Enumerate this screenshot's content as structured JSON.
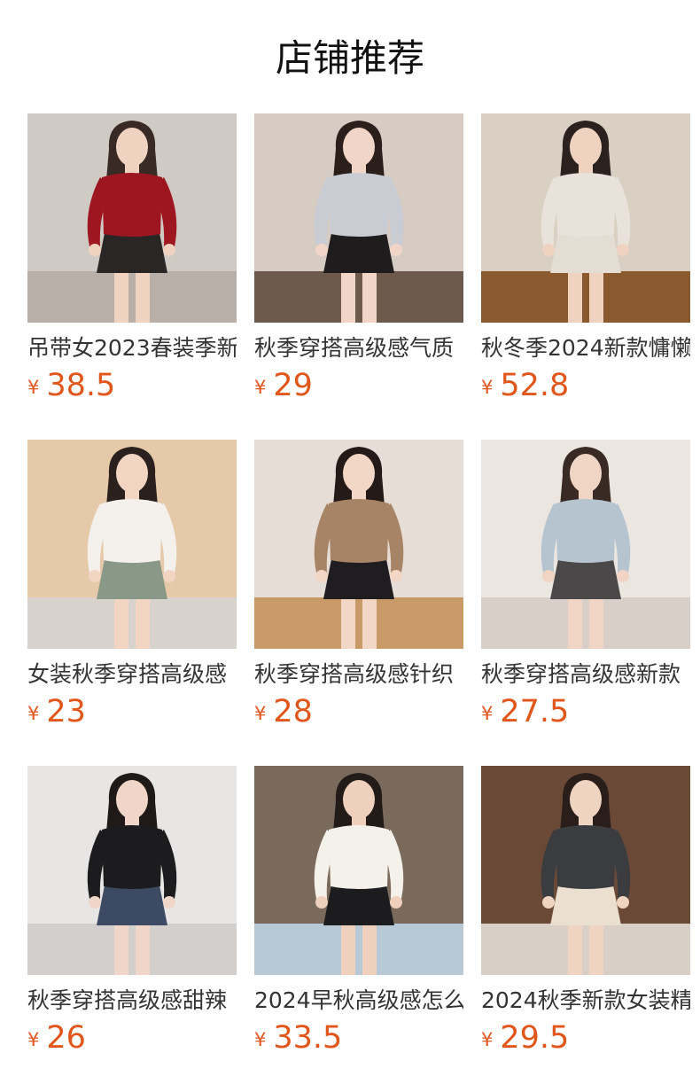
{
  "section_title": "店铺推荐",
  "currency_symbol": "¥",
  "products": [
    {
      "name": "吊带女2023春装季新",
      "price": "38.5",
      "image_palette": {
        "bg": "#cfcac4",
        "top": "#9e1620",
        "skin": "#f0d2c0",
        "hair": "#3a2a26",
        "bottom": "#2b2626",
        "floor": "#b8b0a8"
      }
    },
    {
      "name": "秋季穿搭高级感气质",
      "price": "29",
      "image_palette": {
        "bg": "#d6ccc4",
        "top": "#c9ccd2",
        "skin": "#f1d6c8",
        "hair": "#2b1f1c",
        "bottom": "#1f1c1e",
        "floor": "#6e5a4c"
      }
    },
    {
      "name": "秋冬季2024新款慵懒",
      "price": "52.8",
      "image_palette": {
        "bg": "#d9cfc2",
        "top": "#e8e2da",
        "skin": "#f0d2c0",
        "hair": "#2b2220",
        "bottom": "#e4ddd4",
        "floor": "#8a5a2e"
      }
    },
    {
      "name": "女装秋季穿搭高级感",
      "price": "23",
      "image_palette": {
        "bg": "#e6c9a8",
        "top": "#f4f1ec",
        "skin": "#f2d4c2",
        "hair": "#2a201d",
        "bottom": "#8a9888",
        "floor": "#d8d2cc"
      }
    },
    {
      "name": "秋季穿搭高级感针织",
      "price": "28",
      "image_palette": {
        "bg": "#e6ddd6",
        "top": "#a88466",
        "skin": "#f2d6c6",
        "hair": "#241a17",
        "bottom": "#1f1d1f",
        "floor": "#c89a68"
      }
    },
    {
      "name": "秋季穿搭高级感新款",
      "price": "27.5",
      "image_palette": {
        "bg": "#ece6e0",
        "top": "#b6c4d0",
        "skin": "#f0d4c4",
        "hair": "#3a2a24",
        "bottom": "#4a4848",
        "floor": "#d8d0c8"
      }
    },
    {
      "name": "秋季穿搭高级感甜辣",
      "price": "26",
      "image_palette": {
        "bg": "#e8e6e4",
        "top": "#1c1c1e",
        "skin": "#f0d6c8",
        "hair": "#1f1a18",
        "bottom": "#3c4a64",
        "floor": "#d2cfcc"
      }
    },
    {
      "name": "2024早秋高级感怎么",
      "price": "33.5",
      "image_palette": {
        "bg": "#7a6a5c",
        "top": "#f4f0ea",
        "skin": "#eed0bc",
        "hair": "#231b18",
        "bottom": "#1c1c1e",
        "floor": "#b8c8d4"
      }
    },
    {
      "name": "2024秋季新款女装精",
      "price": "29.5",
      "image_palette": {
        "bg": "#6a4a36",
        "top": "#3a3c40",
        "skin": "#f0d4c2",
        "hair": "#2a1e1a",
        "bottom": "#ebe0cf",
        "floor": "#d8cfc6"
      }
    }
  ]
}
